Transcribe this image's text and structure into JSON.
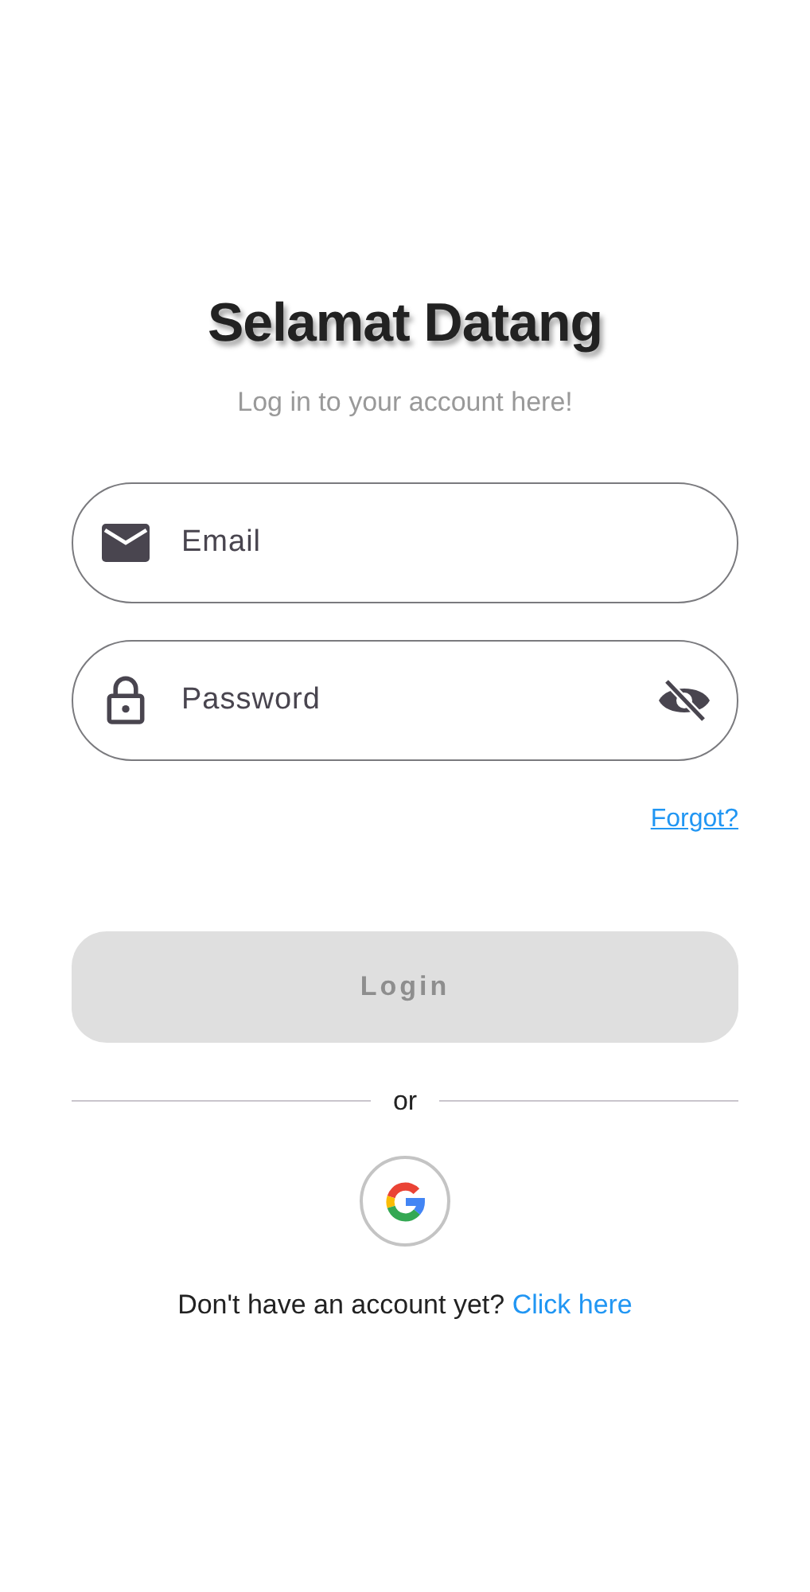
{
  "title": "Selamat Datang",
  "subtitle": "Log in to your account here!",
  "fields": [
    {
      "kind": "email",
      "placeholder": "Email"
    },
    {
      "kind": "password",
      "placeholder": "Password",
      "password_visible": false
    }
  ],
  "forgot_link": "Forgot?",
  "login_button": {
    "label": "Login",
    "disabled": true
  },
  "divider_text": "or",
  "signup": {
    "text": "Don't have an account yet?",
    "link": "Click here"
  }
}
